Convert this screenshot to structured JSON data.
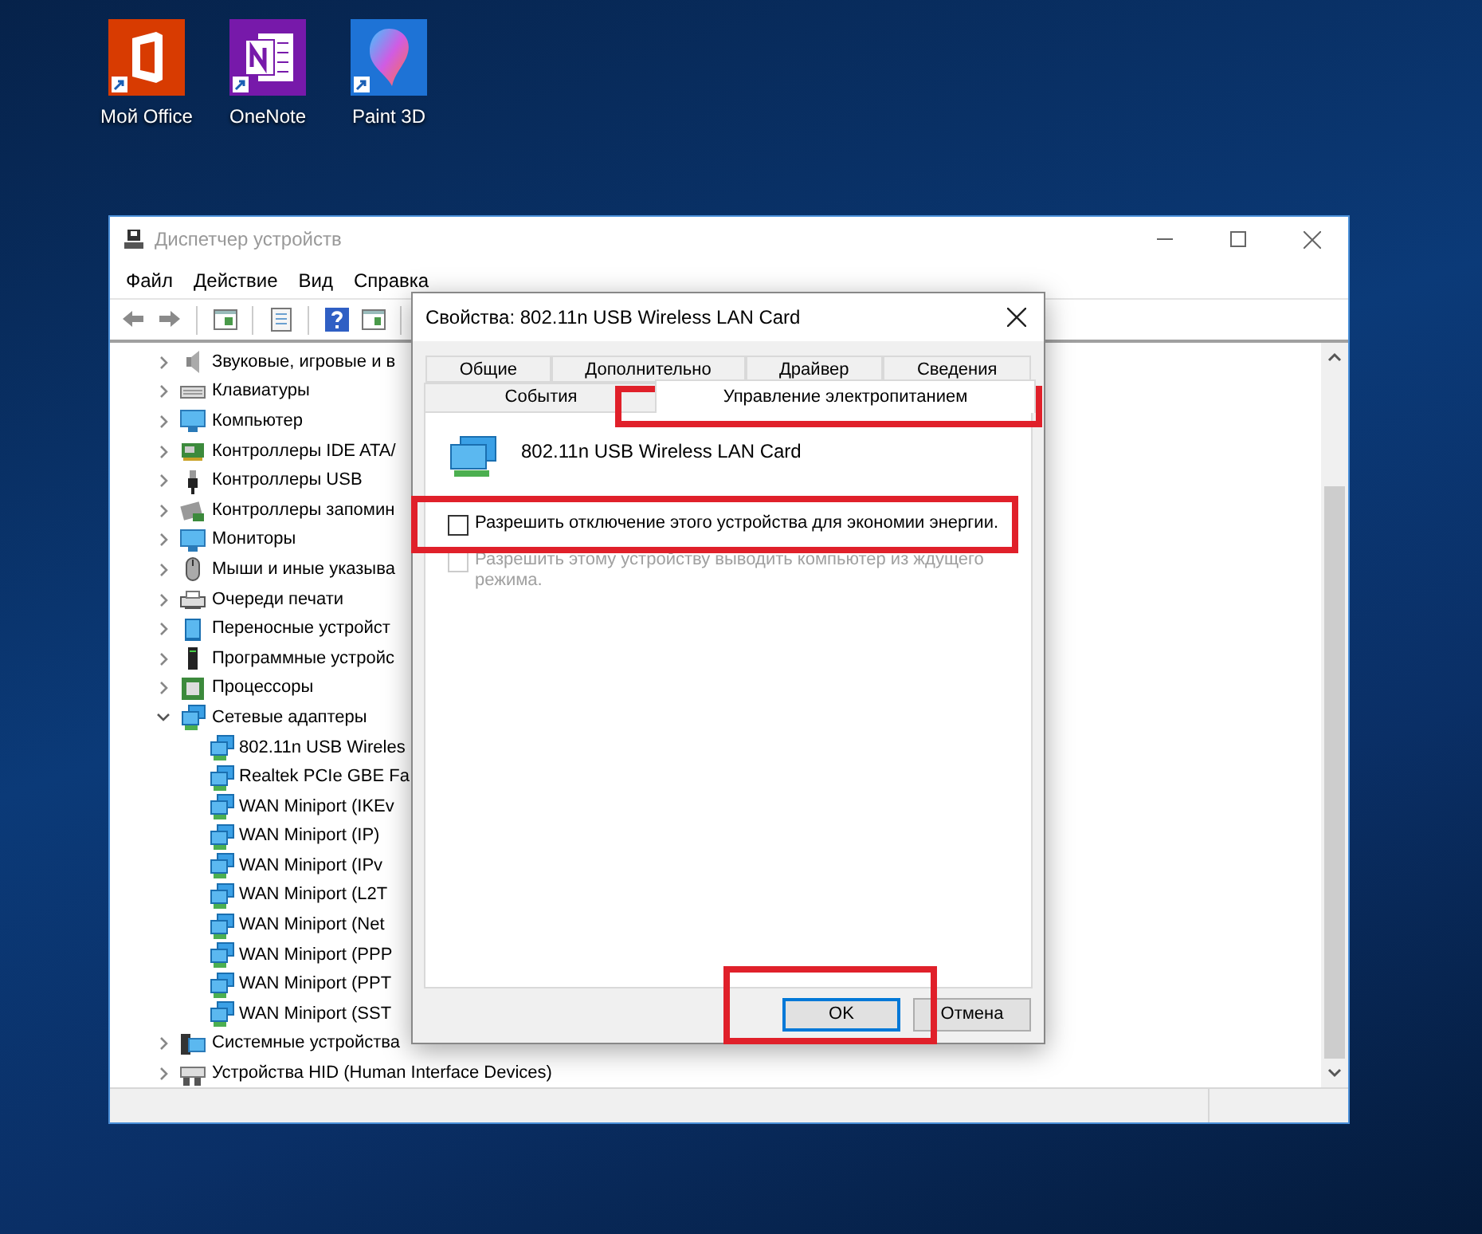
{
  "desktop_icons": [
    {
      "label": "Мой Office",
      "kind": "office"
    },
    {
      "label": "OneNote",
      "kind": "onenote"
    },
    {
      "label": "Paint 3D",
      "kind": "paint"
    }
  ],
  "window": {
    "title": "Диспетчер устройств"
  },
  "menu": [
    "Файл",
    "Действие",
    "Вид",
    "Справка"
  ],
  "tree": [
    {
      "label": "Звуковые, игровые и в",
      "kind": "sound",
      "expanded": false
    },
    {
      "label": "Клавиатуры",
      "kind": "keyboard",
      "expanded": false
    },
    {
      "label": "Компьютер",
      "kind": "computer",
      "expanded": false
    },
    {
      "label": "Контроллеры IDE ATA/",
      "kind": "ide",
      "expanded": false
    },
    {
      "label": "Контроллеры USB",
      "kind": "usb",
      "expanded": false
    },
    {
      "label": "Контроллеры запомин",
      "kind": "storage",
      "expanded": false
    },
    {
      "label": "Мониторы",
      "kind": "computer",
      "expanded": false
    },
    {
      "label": "Мыши и иные указыва",
      "kind": "mouse",
      "expanded": false
    },
    {
      "label": "Очереди печати",
      "kind": "printer",
      "expanded": false
    },
    {
      "label": "Переносные устройст",
      "kind": "portable",
      "expanded": false
    },
    {
      "label": "Программные устройс",
      "kind": "software",
      "expanded": false
    },
    {
      "label": "Процессоры",
      "kind": "cpu",
      "expanded": false
    },
    {
      "label": "Сетевые адаптеры",
      "kind": "network",
      "expanded": true,
      "children": [
        {
          "label": "802.11n USB Wireles",
          "kind": "network"
        },
        {
          "label": "Realtek PCIe GBE Fa",
          "kind": "network"
        },
        {
          "label": "WAN Miniport (IKEv",
          "kind": "network"
        },
        {
          "label": "WAN Miniport (IP)",
          "kind": "network"
        },
        {
          "label": "WAN Miniport (IPv",
          "kind": "network"
        },
        {
          "label": "WAN Miniport (L2T",
          "kind": "network"
        },
        {
          "label": "WAN Miniport (Net",
          "kind": "network"
        },
        {
          "label": "WAN Miniport (PPP",
          "kind": "network"
        },
        {
          "label": "WAN Miniport (PPT",
          "kind": "network"
        },
        {
          "label": "WAN Miniport (SST",
          "kind": "network"
        }
      ]
    },
    {
      "label": "Системные устройства",
      "kind": "system",
      "expanded": false
    },
    {
      "label": "Устройства HID (Human Interface Devices)",
      "kind": "hid",
      "expanded": false
    }
  ],
  "dialog": {
    "title": "Свойства: 802.11n USB Wireless LAN Card",
    "tab_rows": [
      [
        {
          "label": "Общие",
          "selected": false
        },
        {
          "label": "Дополнительно",
          "selected": false
        },
        {
          "label": "Драйвер",
          "selected": false
        },
        {
          "label": "Сведения",
          "selected": false
        }
      ],
      [
        {
          "label": "События",
          "selected": false
        },
        {
          "label": "Управление электропитанием",
          "selected": true
        }
      ]
    ],
    "device_name": "802.11n USB Wireless LAN Card",
    "options": [
      {
        "label": "Разрешить отключение этого устройства для экономии энергии.",
        "checked": false,
        "disabled": false
      },
      {
        "label": "Разрешить этому устройству выводить компьютер из ждущего режима.",
        "checked": false,
        "disabled": true
      }
    ],
    "buttons": [
      {
        "label": "OK",
        "default": true
      },
      {
        "label": "Отмена",
        "default": false
      }
    ]
  }
}
